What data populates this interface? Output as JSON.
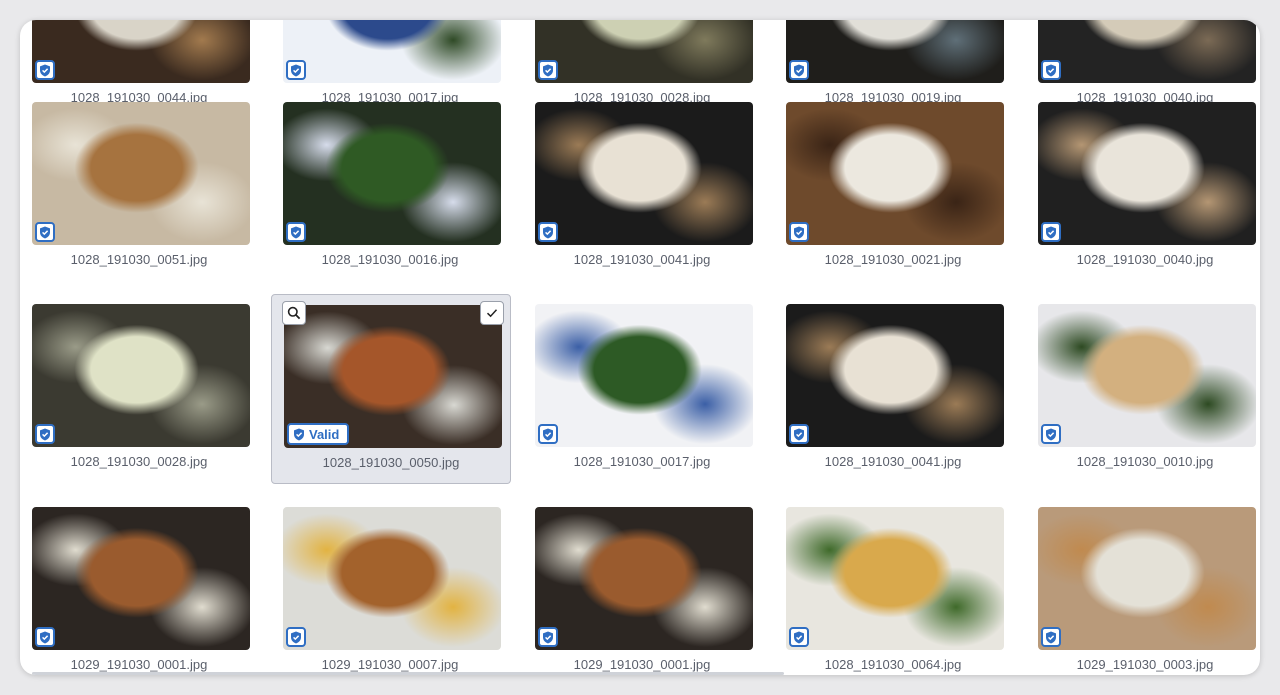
{
  "colors": {
    "accent": "#2f6ec3",
    "selected_bg": "#e4e6ec",
    "filename_text": "#5a5f6b"
  },
  "selected_badge_label": "Valid",
  "rows": [
    [
      {
        "filename": "1028_191030_0044.jpg",
        "palette": [
          "#3a2a1f",
          "#d9d4c8",
          "#a27a4e"
        ]
      },
      {
        "filename": "1028_191030_0017.jpg",
        "palette": [
          "#edf1f7",
          "#2c4a8c",
          "#2f4a26"
        ]
      },
      {
        "filename": "1028_191030_0028.jpg",
        "palette": [
          "#323126",
          "#cdd0b3",
          "#7f7a5c"
        ]
      },
      {
        "filename": "1028_191030_0019.jpg",
        "palette": [
          "#1f1e1b",
          "#e1dfd8",
          "#5f6f78"
        ]
      },
      {
        "filename": "1028_191030_0040.jpg",
        "palette": [
          "#232323",
          "#d4cbb8",
          "#7b6a55"
        ]
      }
    ],
    [
      {
        "filename": "1028_191030_0051.jpg",
        "palette": [
          "#c7b9a3",
          "#a6733f",
          "#e8e3d6"
        ]
      },
      {
        "filename": "1028_191030_0016.jpg",
        "palette": [
          "#243021",
          "#2f5a24",
          "#d6dceb"
        ]
      },
      {
        "filename": "1028_191030_0041.jpg",
        "palette": [
          "#1b1b1b",
          "#e8e1d4",
          "#9b7b56"
        ]
      },
      {
        "filename": "1028_191030_0021.jpg",
        "palette": [
          "#6e4a2c",
          "#ece8df",
          "#3a2416"
        ]
      },
      {
        "filename": "1028_191030_0040.jpg",
        "palette": [
          "#202020",
          "#e9e4da",
          "#b49673"
        ]
      }
    ],
    [
      {
        "filename": "1028_191030_0028.jpg",
        "palette": [
          "#3b3a31",
          "#dfe2c6",
          "#9a9b88"
        ]
      },
      {
        "filename": "1028_191030_0050.jpg",
        "palette": [
          "#3a2e26",
          "#a5562a",
          "#d8d8d2"
        ],
        "selected": true
      },
      {
        "filename": "1028_191030_0017.jpg",
        "palette": [
          "#f1f2f5",
          "#2d5a25",
          "#3b5fa6"
        ]
      },
      {
        "filename": "1028_191030_0041.jpg",
        "palette": [
          "#1b1b1b",
          "#e8e1d4",
          "#9b7b56"
        ]
      },
      {
        "filename": "1028_191030_0010.jpg",
        "palette": [
          "#e7e7ea",
          "#d3b07f",
          "#2d4a22"
        ]
      }
    ],
    [
      {
        "filename": "1029_191030_0001.jpg",
        "palette": [
          "#2c2622",
          "#9a5b2e",
          "#e0dccf"
        ]
      },
      {
        "filename": "1029_191030_0007.jpg",
        "palette": [
          "#dcdcd7",
          "#a3622c",
          "#e2b342"
        ]
      },
      {
        "filename": "1029_191030_0001.jpg",
        "palette": [
          "#2c2622",
          "#9a5b2e",
          "#e0dccf"
        ]
      },
      {
        "filename": "1028_191030_0064.jpg",
        "palette": [
          "#e8e6df",
          "#d9a94c",
          "#3f6a2a"
        ]
      },
      {
        "filename": "1029_191030_0003.jpg",
        "palette": [
          "#b99a7a",
          "#e4e1d7",
          "#c08a4f"
        ]
      }
    ]
  ]
}
